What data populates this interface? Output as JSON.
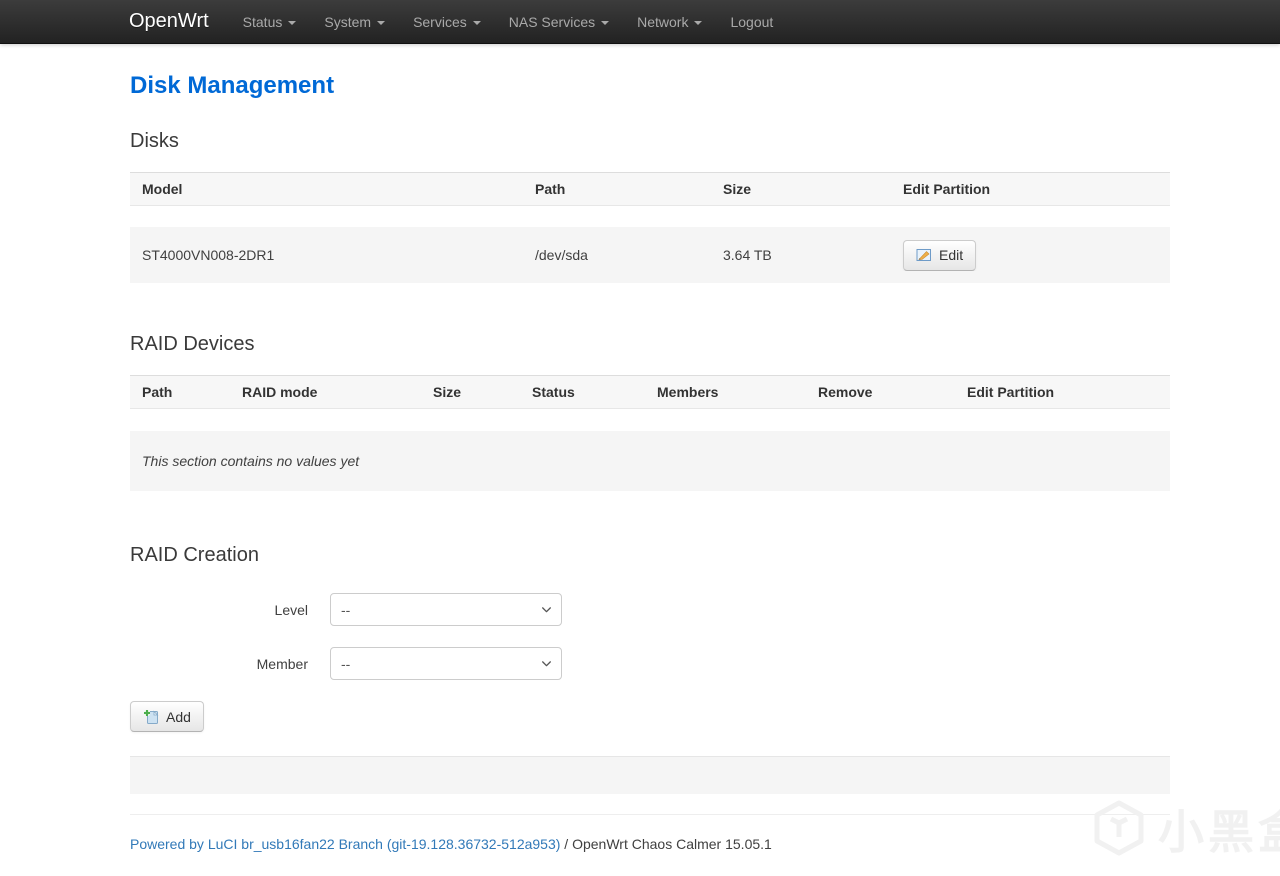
{
  "navbar": {
    "brand": "OpenWrt",
    "items": [
      {
        "label": "Status",
        "caret": true
      },
      {
        "label": "System",
        "caret": true
      },
      {
        "label": "Services",
        "caret": true
      },
      {
        "label": "NAS Services",
        "caret": true
      },
      {
        "label": "Network",
        "caret": true
      },
      {
        "label": "Logout",
        "caret": false
      }
    ]
  },
  "page": {
    "title": "Disk Management"
  },
  "disks": {
    "heading": "Disks",
    "columns": [
      "Model",
      "Path",
      "Size",
      "Edit Partition"
    ],
    "rows": [
      {
        "model": "ST4000VN008-2DR1",
        "path": "/dev/sda",
        "size": "3.64 TB",
        "edit_label": "Edit"
      }
    ]
  },
  "raid_devices": {
    "heading": "RAID Devices",
    "columns": [
      "Path",
      "RAID mode",
      "Size",
      "Status",
      "Members",
      "Remove",
      "Edit Partition"
    ],
    "empty_text": "This section contains no values yet"
  },
  "raid_creation": {
    "heading": "RAID Creation",
    "fields": [
      {
        "label": "Level",
        "value": "--"
      },
      {
        "label": "Member",
        "value": "--"
      }
    ],
    "add_label": "Add"
  },
  "footer": {
    "link_text": "Powered by LuCI br_usb16fan22 Branch (git-19.128.36732-512a953)",
    "plain_text": " / OpenWrt Chaos Calmer 15.05.1"
  },
  "watermark": {
    "text": "小黑盒"
  },
  "colors": {
    "title_blue": "#0069d6",
    "link_blue": "#3179b8",
    "navbar_dark": "#222222",
    "row_gray": "#f5f5f5",
    "header_gray": "#f7f7f7"
  }
}
